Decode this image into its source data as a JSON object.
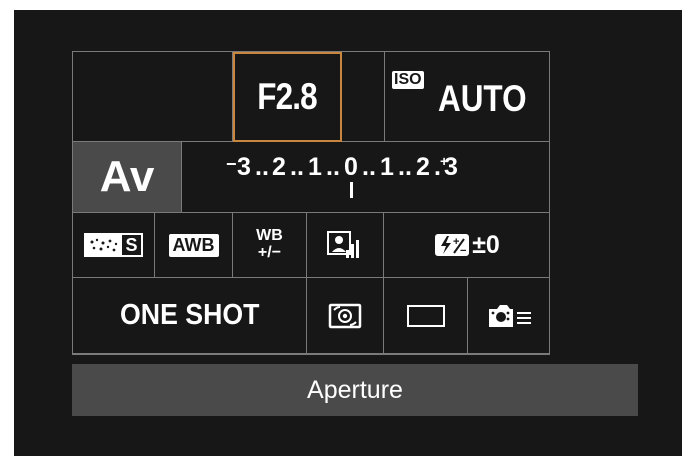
{
  "settings": {
    "aperture": "F2.8",
    "iso_badge": "ISO",
    "iso_value": "AUTO",
    "mode": "Av",
    "exposure_scale": {
      "left3": "3",
      "left2": "2",
      "left1": "1",
      "center": "0",
      "right1": "1",
      "right2": "2",
      "right3": "3",
      "minus_sign": "−",
      "plus_sign": "+"
    },
    "picture_style_letter": "S",
    "white_balance": "AWB",
    "wb_shift_top": "WB",
    "wb_shift_bottom": "+/−",
    "flash_comp_value": "±0",
    "af_mode": "ONE SHOT"
  },
  "status_bar": {
    "label": "Aperture"
  },
  "colors": {
    "selection": "#c8863e",
    "background": "#171717",
    "grid_line": "#7a7a7a",
    "mode_cell": "#4a4a4a",
    "status_bar": "#4a4a4a"
  },
  "icons": {
    "picture_style": "picture-style-icon",
    "white_balance": "awb-icon",
    "wb_shift": "wb-shift-icon",
    "auto_lighting": "auto-lighting-optimizer-icon",
    "flash_compensation": "flash-exposure-comp-icon",
    "metering": "evaluative-metering-icon",
    "drive": "single-shot-drive-icon",
    "custom_controls": "camera-menu-icon"
  }
}
